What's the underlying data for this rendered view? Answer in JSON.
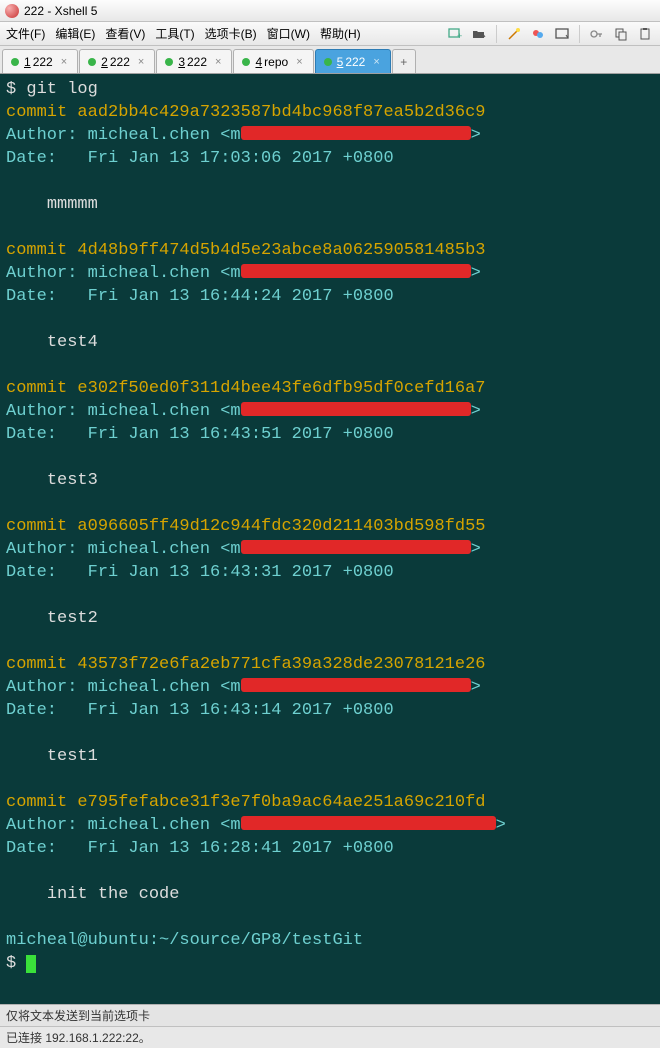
{
  "title": "222 - Xshell 5",
  "menu": {
    "file": "文件(F)",
    "edit": "编辑(E)",
    "view": "查看(V)",
    "tools": "工具(T)",
    "tabs": "选项卡(B)",
    "window": "窗口(W)",
    "help": "帮助(H)"
  },
  "tabs": [
    {
      "num": "1",
      "label": "222",
      "active": false
    },
    {
      "num": "2",
      "label": "222",
      "active": false
    },
    {
      "num": "3",
      "label": "222",
      "active": false
    },
    {
      "num": "4",
      "label": "repo",
      "active": false
    },
    {
      "num": "5",
      "label": "222",
      "active": true
    }
  ],
  "terminal": {
    "prompt1": "$ ",
    "cmd": "git log",
    "commits": [
      {
        "hash": "aad2bb4c429a7323587bd4bc968f87ea5b2d36c9",
        "author": "micheal.chen",
        "date": "Fri Jan 13 17:03:06 2017 +0800",
        "msg": "mmmmm",
        "redactW": 230
      },
      {
        "hash": "4d48b9ff474d5b4d5e23abce8a062590581485b3",
        "author": "micheal.chen",
        "date": "Fri Jan 13 16:44:24 2017 +0800",
        "msg": "test4",
        "redactW": 230
      },
      {
        "hash": "e302f50ed0f311d4bee43fe6dfb95df0cefd16a7",
        "author": "micheal.chen",
        "date": "Fri Jan 13 16:43:51 2017 +0800",
        "msg": "test3",
        "redactW": 230
      },
      {
        "hash": "a096605ff49d12c944fdc320d211403bd598fd55",
        "author": "micheal.chen",
        "date": "Fri Jan 13 16:43:31 2017 +0800",
        "msg": "test2",
        "redactW": 230
      },
      {
        "hash": "43573f72e6fa2eb771cfa39a328de23078121e26",
        "author": "micheal.chen",
        "date": "Fri Jan 13 16:43:14 2017 +0800",
        "msg": "test1",
        "redactW": 230
      },
      {
        "hash": "e795fefabce31f3e7f0ba9ac64ae251a69c210fd",
        "author": "micheal.chen",
        "date": "Fri Jan 13 16:28:41 2017 +0800",
        "msg": "init the code",
        "redactW": 255
      }
    ],
    "path": "micheal@ubuntu:~/source/GP8/testGit",
    "prompt2": "$ "
  },
  "footer": {
    "line1": "仅将文本发送到当前选项卡",
    "line2": "已连接 192.168.1.222:22。"
  }
}
